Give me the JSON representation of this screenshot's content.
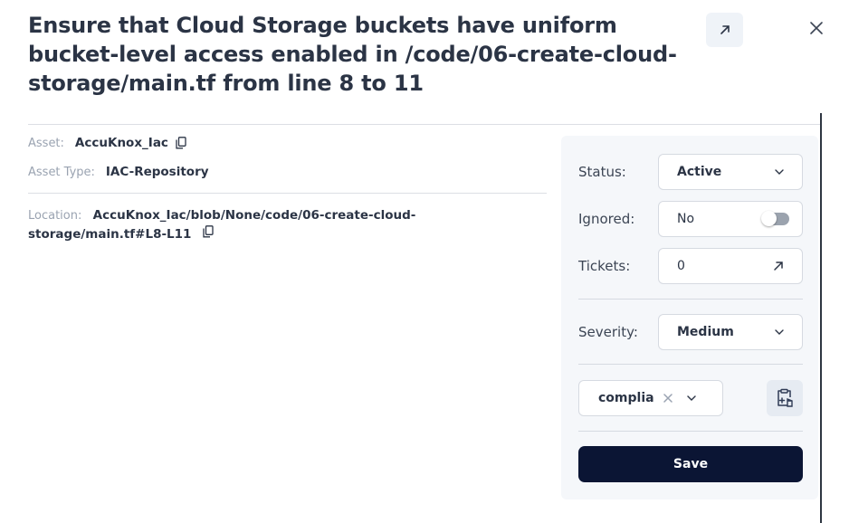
{
  "title": "Ensure that Cloud Storage buckets have uniform bucket-level access enabled in /code/06-create-cloud-storage/main.tf from line 8 to 11",
  "asset": {
    "label": "Asset:",
    "value": "AccuKnox_Iac"
  },
  "asset_type": {
    "label": "Asset Type:",
    "value": "IAC-Repository"
  },
  "location": {
    "label": "Location:",
    "value": "AccuKnox_Iac/blob/None/code/06-create-cloud-storage/main.tf#L8-L11"
  },
  "panel": {
    "status": {
      "label": "Status:",
      "value": "Active"
    },
    "ignored": {
      "label": "Ignored:",
      "value": "No",
      "toggle_on": false
    },
    "tickets": {
      "label": "Tickets:",
      "value": "0"
    },
    "severity": {
      "label": "Severity:",
      "value": "Medium"
    },
    "tags": {
      "value": "compliance"
    },
    "save_label": "Save"
  },
  "icons": {
    "open_external": "arrow-up-right-icon",
    "close": "close-icon",
    "copy": "copy-icon",
    "dropdown": "chevron-down-icon",
    "clear": "clear-icon",
    "add_tag": "add-tag-icon"
  },
  "colors": {
    "save_button": "#0b1534",
    "panel_background": "#f5f7fa",
    "title": "#2b3445"
  }
}
